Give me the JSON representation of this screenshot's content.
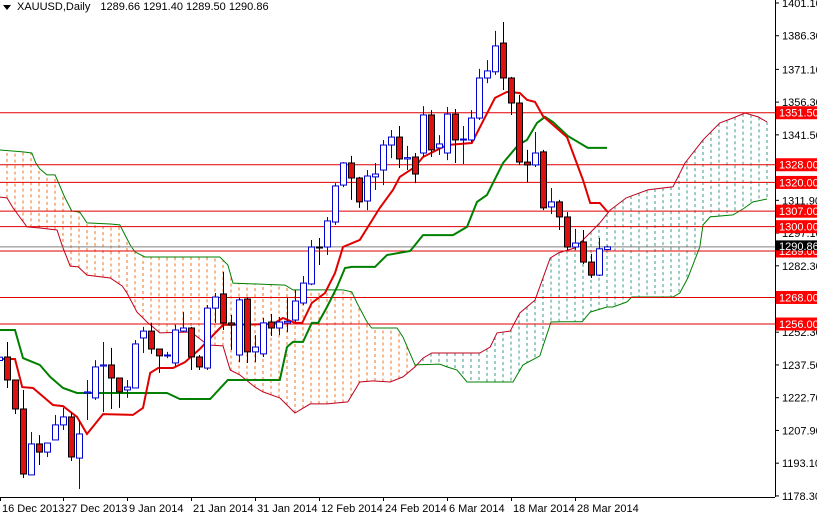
{
  "header": {
    "symbol_timeframe": "XAUUSD,Daily",
    "ohlc": "1289.66 1291.40 1289.50 1290.86"
  },
  "colors": {
    "bull_outline": "#0000d0",
    "bear_fill": "#dd1111",
    "level_line": "#e00000",
    "tenkan": "#e00000",
    "kijun": "#008000",
    "span_a": "#c00020",
    "span_b": "#008000",
    "cloud_bear": "#e8742a",
    "cloud_bull": "#3a9a88",
    "price_line": "#808080"
  },
  "chart_data": {
    "type": "candlestick",
    "symbol": "XAUUSD",
    "timeframe": "Daily",
    "ylim": [
      1178.3,
      1401.1
    ],
    "y_ticks": [
      "1401.10",
      "1386.30",
      "1371.10",
      "1356.30",
      "1341.50",
      "1311.90",
      "1297.10",
      "1282.30",
      "1252.30",
      "1237.50",
      "1222.70",
      "1207.90",
      "1193.10",
      "1178.30"
    ],
    "x_labels": [
      {
        "bar": 0,
        "label": "16 Dec 2013"
      },
      {
        "bar": 8,
        "label": "27 Dec 2013"
      },
      {
        "bar": 16,
        "label": "9 Jan 2014"
      },
      {
        "bar": 24,
        "label": "21 Jan 2014"
      },
      {
        "bar": 32,
        "label": "31 Jan 2014"
      },
      {
        "bar": 40,
        "label": "12 Feb 2014"
      },
      {
        "bar": 48,
        "label": "24 Feb 2014"
      },
      {
        "bar": 56,
        "label": "6 Mar 2014"
      },
      {
        "bar": 64,
        "label": "18 Mar 2014"
      },
      {
        "bar": 72,
        "label": "28 Mar 2014"
      }
    ],
    "current_price": "1290.86",
    "levels": [
      "1351.50",
      "1328.00",
      "1320.00",
      "1307.00",
      "1300.00",
      "1289.00",
      "1268.00",
      "1256.00"
    ],
    "ohlc": [
      [
        1239.5,
        1243,
        1238,
        1241
      ],
      [
        1241.1,
        1247.9,
        1227.1,
        1230.7
      ],
      [
        1230.7,
        1230.7,
        1215.3,
        1217.6
      ],
      [
        1217.6,
        1226.2,
        1186.4,
        1188.2
      ],
      [
        1187.8,
        1207.2,
        1187.8,
        1201.8
      ],
      [
        1201.8,
        1205.8,
        1192.3,
        1198.1
      ],
      [
        1198.1,
        1202.2,
        1195.9,
        1202.2
      ],
      [
        1203.6,
        1214.9,
        1203.6,
        1210.4
      ],
      [
        1210.4,
        1218.1,
        1208.1,
        1214.0
      ],
      [
        1214.0,
        1216.2,
        1194.1,
        1195.9
      ],
      [
        1195.4,
        1212.6,
        1181.4,
        1206.3
      ],
      [
        1224.8,
        1230.7,
        1212.6,
        1225.3
      ],
      [
        1222.6,
        1239.7,
        1221.7,
        1236.6
      ],
      [
        1237.0,
        1247.9,
        1216.2,
        1237.5
      ],
      [
        1237.5,
        1245.2,
        1217.6,
        1231.6
      ],
      [
        1231.6,
        1231.6,
        1218.1,
        1225.3
      ],
      [
        1226.2,
        1230.7,
        1222.6,
        1227.5
      ],
      [
        1227.1,
        1248.8,
        1227.1,
        1247.0
      ],
      [
        1249.7,
        1254.7,
        1242.9,
        1252.8
      ],
      [
        1252.8,
        1256.5,
        1242.5,
        1244.7
      ],
      [
        1244.7,
        1244.7,
        1233.9,
        1241.6
      ],
      [
        1241.6,
        1243.4,
        1240.6,
        1242.0
      ],
      [
        1238.4,
        1255.6,
        1237.0,
        1253.3
      ],
      [
        1252.8,
        1261.4,
        1252.4,
        1254.2
      ],
      [
        1254.2,
        1254.7,
        1235.2,
        1241.1
      ],
      [
        1241.1,
        1242.0,
        1235.2,
        1236.6
      ],
      [
        1236.1,
        1264.6,
        1235.2,
        1263.2
      ],
      [
        1263.2,
        1270.0,
        1256.5,
        1268.2
      ],
      [
        1269.6,
        1279.5,
        1253.3,
        1256.5
      ],
      [
        1256.5,
        1260.1,
        1244.3,
        1255.6
      ],
      [
        1242.0,
        1268.2,
        1238.8,
        1266.9
      ],
      [
        1267.3,
        1268.2,
        1238.4,
        1243.4
      ],
      [
        1243.4,
        1251.0,
        1238.8,
        1245.6
      ],
      [
        1242.5,
        1258.7,
        1241.1,
        1256.5
      ],
      [
        1256.9,
        1260.5,
        1250.6,
        1254.2
      ],
      [
        1254.2,
        1259.2,
        1251.0,
        1256.9
      ],
      [
        1256.5,
        1267.8,
        1252.4,
        1257.2
      ],
      [
        1257.8,
        1271.4,
        1256.9,
        1266.4
      ],
      [
        1265.5,
        1277.7,
        1264.6,
        1274.5
      ],
      [
        1274.1,
        1294.0,
        1273.6,
        1290.8
      ],
      [
        1290.8,
        1294.9,
        1282.7,
        1290.6
      ],
      [
        1290.8,
        1304.4,
        1287.2,
        1302.6
      ],
      [
        1302.1,
        1319.7,
        1300.8,
        1318.4
      ],
      [
        1318.8,
        1329.2,
        1317.9,
        1328.8
      ],
      [
        1328.8,
        1332.0,
        1312.1,
        1322.0
      ],
      [
        1322.0,
        1322.5,
        1308.5,
        1311.2
      ],
      [
        1311.6,
        1325.6,
        1307.5,
        1322.9
      ],
      [
        1322.5,
        1328.8,
        1316.6,
        1323.8
      ],
      [
        1325.6,
        1339.2,
        1318.8,
        1336.9
      ],
      [
        1336.9,
        1343.7,
        1331.0,
        1340.5
      ],
      [
        1340.5,
        1345.5,
        1326.5,
        1330.6
      ],
      [
        1330.6,
        1336.5,
        1325.6,
        1331.2
      ],
      [
        1331.5,
        1333.3,
        1319.7,
        1323.8
      ],
      [
        1333.3,
        1354.5,
        1331.5,
        1350.5
      ],
      [
        1350.5,
        1352.7,
        1331.5,
        1334.7
      ],
      [
        1335.6,
        1341.4,
        1332.4,
        1337.4
      ],
      [
        1333.3,
        1354.1,
        1330.1,
        1350.9
      ],
      [
        1350.9,
        1353.2,
        1328.8,
        1339.2
      ],
      [
        1339.2,
        1345.5,
        1328.3,
        1339.6
      ],
      [
        1339.2,
        1352.7,
        1338.3,
        1349.1
      ],
      [
        1349.1,
        1371.3,
        1348.2,
        1367.2
      ],
      [
        1367.2,
        1375.3,
        1364.9,
        1370.4
      ],
      [
        1370.0,
        1388.5,
        1368.6,
        1381.7
      ],
      [
        1383.0,
        1392.5,
        1361.8,
        1367.2
      ],
      [
        1367.2,
        1367.7,
        1350.5,
        1355.9
      ],
      [
        1355.9,
        1359.5,
        1327.9,
        1329.2
      ],
      [
        1329.2,
        1334.7,
        1320.2,
        1327.9
      ],
      [
        1327.9,
        1342.8,
        1327.0,
        1333.3
      ],
      [
        1333.8,
        1334.7,
        1307.5,
        1308.5
      ],
      [
        1308.9,
        1317.5,
        1305.7,
        1311.2
      ],
      [
        1311.2,
        1312.1,
        1298.5,
        1304.4
      ],
      [
        1304.4,
        1306.6,
        1289.5,
        1290.8
      ],
      [
        1290.8,
        1299.0,
        1289.5,
        1292.6
      ],
      [
        1293.1,
        1298.5,
        1283.1,
        1284.0
      ],
      [
        1284.0,
        1287.7,
        1276.8,
        1278.1
      ],
      [
        1278.1,
        1294.9,
        1277.7,
        1290.0
      ],
      [
        1289.66,
        1291.4,
        1289.5,
        1290.86
      ]
    ],
    "tenkan": [
      [
        0,
        1240.2
      ],
      [
        2,
        1240.2
      ],
      [
        2.9,
        1227.5
      ],
      [
        4.25,
        1227.1
      ],
      [
        6.75,
        1219.4
      ],
      [
        8,
        1218.9
      ],
      [
        9.75,
        1214
      ],
      [
        11,
        1206.3
      ],
      [
        13,
        1215.3
      ],
      [
        16.75,
        1214.9
      ],
      [
        18,
        1218.1
      ],
      [
        18.9,
        1233.9
      ],
      [
        19.9,
        1236.1
      ],
      [
        21.75,
        1236.1
      ],
      [
        23.25,
        1238.8
      ],
      [
        25.1,
        1244.7
      ],
      [
        28,
        1255.6
      ],
      [
        34.25,
        1256
      ],
      [
        35.5,
        1258.7
      ],
      [
        37,
        1256.5
      ],
      [
        37.9,
        1256.5
      ],
      [
        39.1,
        1265.5
      ],
      [
        40.75,
        1270
      ],
      [
        42,
        1279
      ],
      [
        43,
        1290.8
      ],
      [
        45.1,
        1294
      ],
      [
        47.6,
        1308.5
      ],
      [
        49.25,
        1316.6
      ],
      [
        50.1,
        1322.5
      ],
      [
        52,
        1327
      ],
      [
        53,
        1331.5
      ],
      [
        56,
        1336.9
      ],
      [
        59.1,
        1337.8
      ],
      [
        62,
        1358.2
      ],
      [
        63.5,
        1360.9
      ],
      [
        65.1,
        1360.4
      ],
      [
        66,
        1357.3
      ],
      [
        67,
        1356.4
      ],
      [
        68,
        1350
      ],
      [
        71,
        1340.5
      ],
      [
        73,
        1321.1
      ],
      [
        73.9,
        1310.7
      ],
      [
        75.1,
        1310.7
      ],
      [
        76.1,
        1306.6
      ]
    ],
    "kijun": [
      [
        0,
        1253.3
      ],
      [
        2,
        1253.3
      ],
      [
        3,
        1240.6
      ],
      [
        5.1,
        1237.5
      ],
      [
        6.4,
        1232.1
      ],
      [
        8,
        1227.1
      ],
      [
        9.75,
        1224.8
      ],
      [
        21,
        1224.8
      ],
      [
        22.6,
        1222.1
      ],
      [
        26.4,
        1222.1
      ],
      [
        28.6,
        1230.7
      ],
      [
        35.1,
        1230.7
      ],
      [
        36,
        1245.6
      ],
      [
        36.75,
        1247.9
      ],
      [
        38,
        1247.9
      ],
      [
        39.1,
        1256.5
      ],
      [
        39.9,
        1256.5
      ],
      [
        41,
        1263.7
      ],
      [
        42.25,
        1272.7
      ],
      [
        43.25,
        1281.3
      ],
      [
        44.1,
        1281.8
      ],
      [
        47,
        1281.8
      ],
      [
        48.5,
        1287.2
      ],
      [
        51.4,
        1289
      ],
      [
        53,
        1296.2
      ],
      [
        56.75,
        1296.2
      ],
      [
        58.5,
        1299.9
      ],
      [
        59.75,
        1311.2
      ],
      [
        61,
        1314.3
      ],
      [
        63,
        1328.8
      ],
      [
        64.9,
        1336.9
      ],
      [
        66,
        1339.2
      ],
      [
        67.25,
        1346.9
      ],
      [
        68.25,
        1349.6
      ],
      [
        69.25,
        1347.3
      ],
      [
        71.1,
        1341
      ],
      [
        73.6,
        1335.6
      ],
      [
        76,
        1335.6
      ]
    ],
    "span_a": [
      [
        0,
        1313.4
      ],
      [
        1,
        1313
      ],
      [
        1.75,
        1308.5
      ],
      [
        3.5,
        1299.9
      ],
      [
        5.1,
        1299.4
      ],
      [
        7.25,
        1298.5
      ],
      [
        8,
        1290.4
      ],
      [
        8.9,
        1282.2
      ],
      [
        9.9,
        1281.8
      ],
      [
        11,
        1278.1
      ],
      [
        13.9,
        1276.8
      ],
      [
        15.4,
        1273.2
      ],
      [
        16,
        1270
      ],
      [
        17.25,
        1261.4
      ],
      [
        18.5,
        1256.9
      ],
      [
        20.1,
        1252
      ],
      [
        24,
        1252.4
      ],
      [
        26.1,
        1246.5
      ],
      [
        28,
        1246.1
      ],
      [
        28.9,
        1235.2
      ],
      [
        30.1,
        1233
      ],
      [
        32,
        1227.5
      ],
      [
        33,
        1225.3
      ],
      [
        35.1,
        1222.6
      ],
      [
        37,
        1215.8
      ],
      [
        38.9,
        1219.9
      ],
      [
        41,
        1219.9
      ],
      [
        43.6,
        1220.8
      ],
      [
        45.1,
        1229.8
      ],
      [
        46.75,
        1230.3
      ],
      [
        48.9,
        1229.8
      ],
      [
        50.5,
        1232.1
      ],
      [
        52,
        1236.6
      ],
      [
        53,
        1240.6
      ],
      [
        54.1,
        1242.9
      ],
      [
        60.1,
        1242.9
      ],
      [
        61.4,
        1245.6
      ],
      [
        62.25,
        1252
      ],
      [
        63.9,
        1252.8
      ],
      [
        65.1,
        1261
      ],
      [
        67,
        1266.8
      ],
      [
        68.9,
        1285.8
      ],
      [
        69.9,
        1288.1
      ],
      [
        72,
        1290.4
      ],
      [
        73.6,
        1296.2
      ],
      [
        75.1,
        1301.7
      ],
      [
        76.4,
        1307.5
      ],
      [
        78.4,
        1313
      ],
      [
        81.1,
        1316.6
      ],
      [
        84.25,
        1318
      ],
      [
        85.75,
        1328.8
      ],
      [
        88,
        1339.2
      ],
      [
        90.1,
        1346.9
      ],
      [
        91.75,
        1349.1
      ],
      [
        93.25,
        1351.4
      ],
      [
        94.9,
        1349.6
      ],
      [
        96,
        1347.3
      ]
    ],
    "span_b": [
      [
        0,
        1334.7
      ],
      [
        3,
        1333.8
      ],
      [
        4.1,
        1333.3
      ],
      [
        4.6,
        1328.8
      ],
      [
        5.1,
        1326.1
      ],
      [
        6,
        1323.4
      ],
      [
        7,
        1323.4
      ],
      [
        7.4,
        1320.2
      ],
      [
        8.25,
        1313
      ],
      [
        9.1,
        1307.1
      ],
      [
        10.1,
        1306.6
      ],
      [
        11,
        1301.7
      ],
      [
        13.9,
        1301.2
      ],
      [
        15.1,
        1300.8
      ],
      [
        16.4,
        1291.7
      ],
      [
        17,
        1288.6
      ],
      [
        18.25,
        1286.3
      ],
      [
        27.6,
        1286.3
      ],
      [
        28.6,
        1282.7
      ],
      [
        29.25,
        1274.5
      ],
      [
        35.75,
        1273.6
      ],
      [
        36.75,
        1271.4
      ],
      [
        43,
        1271.4
      ],
      [
        44.1,
        1270.5
      ],
      [
        44.75,
        1265.5
      ],
      [
        46,
        1256.9
      ],
      [
        46.6,
        1254.2
      ],
      [
        49.75,
        1254.2
      ],
      [
        50.5,
        1250.1
      ],
      [
        52,
        1237.5
      ],
      [
        55.1,
        1237.9
      ],
      [
        56,
        1236.6
      ],
      [
        57.25,
        1235.2
      ],
      [
        58.5,
        1229.8
      ],
      [
        64.25,
        1229.8
      ],
      [
        65.5,
        1237.5
      ],
      [
        67.6,
        1241.6
      ],
      [
        69,
        1256.9
      ],
      [
        70.5,
        1257
      ],
      [
        72.9,
        1257
      ],
      [
        73.9,
        1261.4
      ],
      [
        76,
        1263.7
      ],
      [
        76.75,
        1263.7
      ],
      [
        78.5,
        1266
      ],
      [
        79.1,
        1268.2
      ],
      [
        84.25,
        1268.2
      ],
      [
        85.1,
        1270
      ],
      [
        86.1,
        1276.8
      ],
      [
        87.6,
        1290.8
      ],
      [
        88,
        1300.8
      ],
      [
        88.9,
        1304.4
      ],
      [
        91.75,
        1305.3
      ],
      [
        93,
        1308
      ],
      [
        94.25,
        1311.2
      ],
      [
        96,
        1312.5
      ]
    ]
  }
}
